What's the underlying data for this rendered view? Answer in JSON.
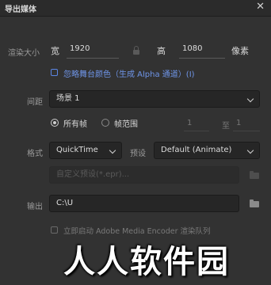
{
  "window": {
    "title": "导出媒体",
    "close_glyph": "✕"
  },
  "render_size": {
    "label": "渲染大小",
    "width_label": "宽",
    "width_value": "1920",
    "height_label": "高",
    "height_value": "1080",
    "unit": "像素",
    "lock_icon": "lock-icon"
  },
  "ignore_stage_color": {
    "label": "忽略舞台颜色（生成 Alpha 通道）(I)",
    "checked": false
  },
  "span": {
    "label": "间距",
    "selected": "场景 1"
  },
  "frames": {
    "all_frames_label": "所有帧",
    "frame_range_label": "帧范围",
    "selected": "所有帧",
    "range_start": "1",
    "range_to": "至",
    "range_end": "1"
  },
  "format": {
    "label": "格式",
    "selected": "QuickTime",
    "preset_label": "预设",
    "preset_selected": "Default (Animate)",
    "custom_placeholder": "自定义预设(*.epr)..."
  },
  "output": {
    "label": "输出",
    "path": "C:\\U"
  },
  "launch_encoder": {
    "label": "立即启动 Adobe Media Encoder 渲染队列",
    "checked": false
  },
  "watermark": {
    "text": "人人软件园"
  },
  "colors": {
    "accent": "#5b86e5",
    "background": "#323232",
    "field": "#262626"
  }
}
